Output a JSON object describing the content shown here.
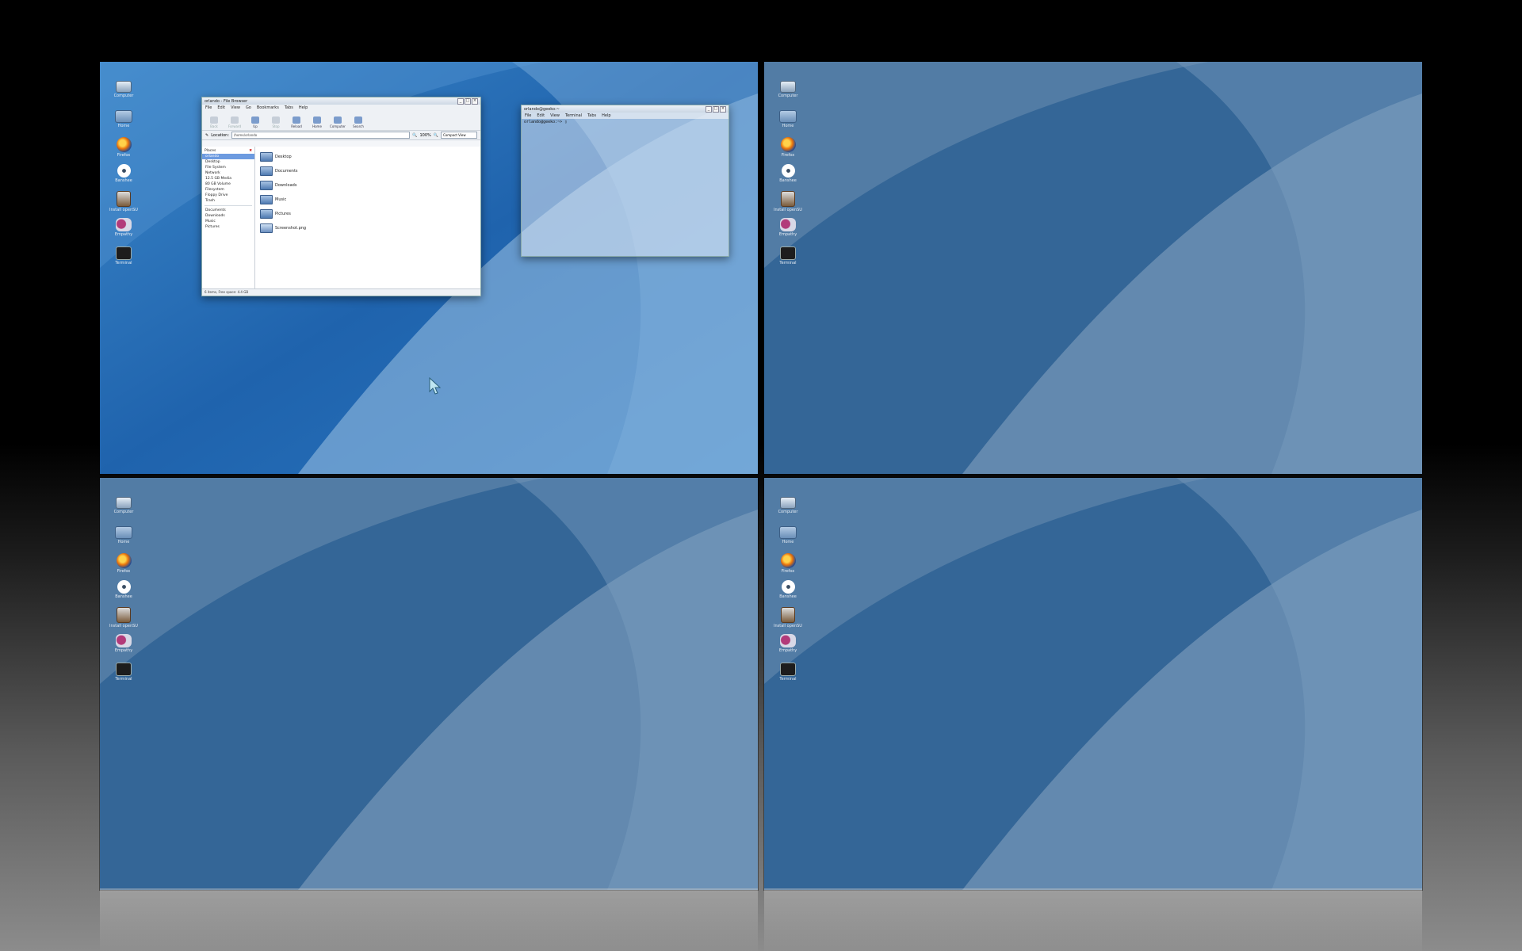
{
  "desktop_icons": [
    {
      "label": "Computer",
      "icon": "computer-icon"
    },
    {
      "label": "Home",
      "icon": "home-folder-icon"
    },
    {
      "label": "Firefox",
      "icon": "firefox-icon"
    },
    {
      "label": "Banshee",
      "icon": "banshee-icon"
    },
    {
      "label": "Install openSUSE",
      "icon": "installer-icon"
    },
    {
      "label": "Empathy",
      "icon": "chat-icon"
    },
    {
      "label": "Terminal",
      "icon": "terminal-icon"
    }
  ],
  "file_browser": {
    "title": "orlando - File Browser",
    "menu": [
      "File",
      "Edit",
      "View",
      "Go",
      "Bookmarks",
      "Tabs",
      "Help"
    ],
    "toolbar": [
      "Back",
      "Forward",
      "Up",
      "Stop",
      "Reload",
      "Home",
      "Computer",
      "Search"
    ],
    "location_label": "Location:",
    "location_value": "/home/orlando",
    "zoom": "100%",
    "view_mode": "Compact View",
    "places_header": "Places",
    "places": [
      "orlando",
      "Desktop",
      "File System",
      "Network",
      "12.5 GB Media",
      "80 GB Volume",
      "Filesystem",
      "Floppy Drive",
      "Trash"
    ],
    "bookmarks": [
      "Documents",
      "Downloads",
      "Music",
      "Pictures"
    ],
    "items": [
      "Desktop",
      "Documents",
      "Downloads",
      "Music",
      "Pictures",
      "Screenshot.png"
    ],
    "status": "6 items, Free space: 4.4 GB"
  },
  "terminal": {
    "title": "orlando@geeko:~",
    "menu": [
      "File",
      "Edit",
      "View",
      "Terminal",
      "Tabs",
      "Help"
    ],
    "prompt": "orlando@geeko:~> "
  },
  "colors": {
    "wallpaper": "#2d6fb5",
    "selection": "#6d9be0"
  }
}
